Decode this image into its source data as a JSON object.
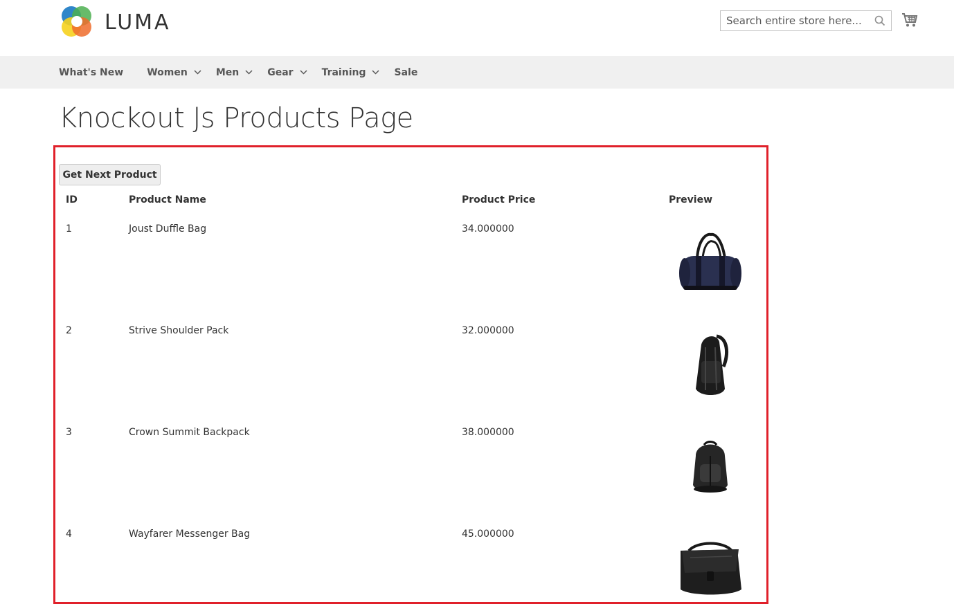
{
  "header": {
    "logo_text": "LUMA",
    "search_placeholder": "Search entire store here..."
  },
  "nav": {
    "items": [
      {
        "label": "What's New",
        "has_dropdown": false
      },
      {
        "label": "Women",
        "has_dropdown": true
      },
      {
        "label": "Men",
        "has_dropdown": true
      },
      {
        "label": "Gear",
        "has_dropdown": true
      },
      {
        "label": "Training",
        "has_dropdown": true
      },
      {
        "label": "Sale",
        "has_dropdown": false
      }
    ]
  },
  "page": {
    "title": "Knockout Js Products Page",
    "button_label": "Get Next Product"
  },
  "table": {
    "headers": {
      "id": "ID",
      "name": "Product Name",
      "price": "Product Price",
      "preview": "Preview"
    },
    "rows": [
      {
        "id": "1",
        "name": "Joust Duffle Bag",
        "price": "34.000000",
        "image": "duffle-bag"
      },
      {
        "id": "2",
        "name": "Strive Shoulder Pack",
        "price": "32.000000",
        "image": "shoulder-pack"
      },
      {
        "id": "3",
        "name": "Crown Summit Backpack",
        "price": "38.000000",
        "image": "backpack"
      },
      {
        "id": "4",
        "name": "Wayfarer Messenger Bag",
        "price": "45.000000",
        "image": "messenger-bag"
      }
    ]
  },
  "colors": {
    "frame": "#e0202a",
    "nav_bg": "#f0f0f0",
    "text": "#333333"
  }
}
